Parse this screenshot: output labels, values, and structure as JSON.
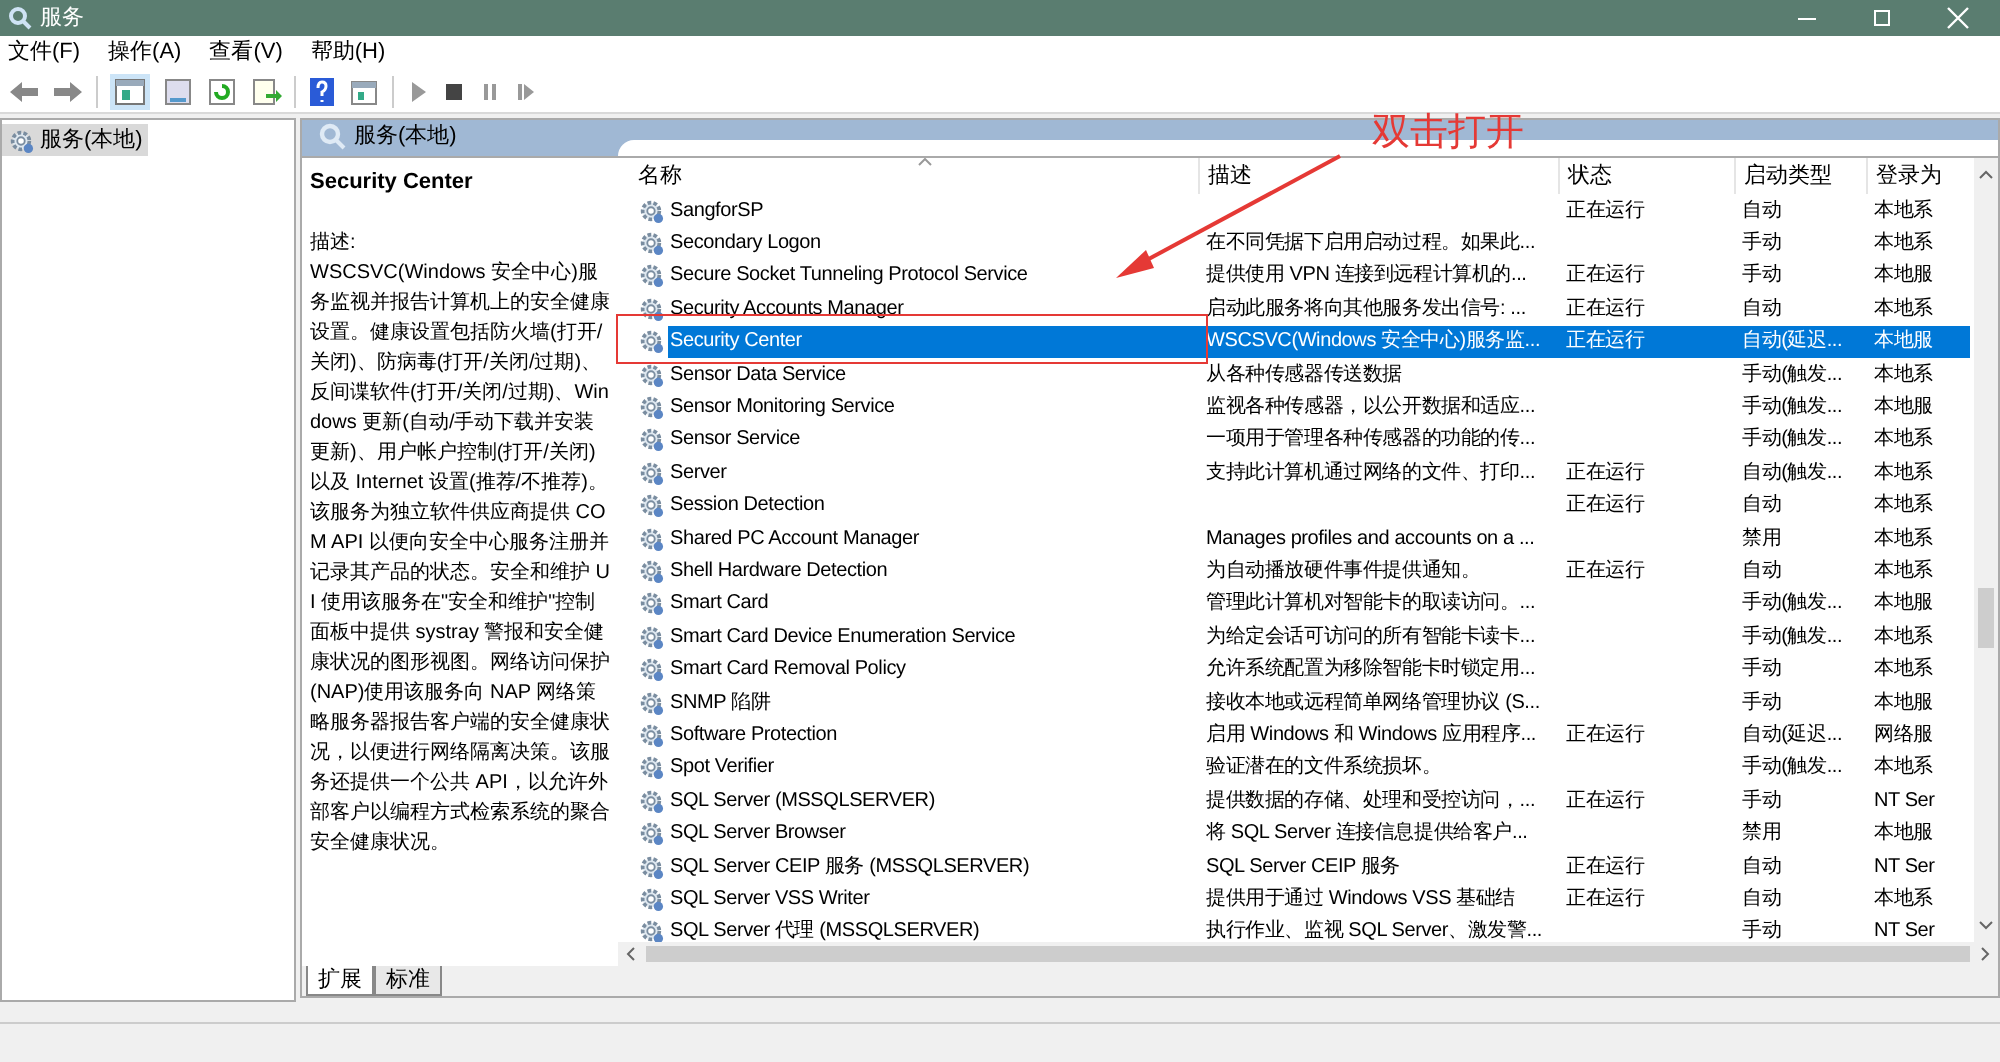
{
  "window": {
    "title": "服务"
  },
  "menu": [
    "文件(F)",
    "操作(A)",
    "查看(V)",
    "帮助(H)"
  ],
  "tree": {
    "items": [
      {
        "label": "服务(本地)",
        "selected": true
      }
    ]
  },
  "panel": {
    "title": "服务(本地)"
  },
  "details": {
    "service_name": "Security Center",
    "description_label": "描述:",
    "description": "WSCSVC(Windows 安全中心)服务监视并报告计算机上的安全健康设置。健康设置包括防火墙(打开/关闭)、防病毒(打开/关闭/过期)、反间谍软件(打开/关闭/过期)、Windows 更新(自动/手动下载并安装更新)、用户帐户控制(打开/关闭)以及 Internet 设置(推荐/不推荐)。该服务为独立软件供应商提供 COM API 以便向安全中心服务注册并记录其产品的状态。安全和维护 UI 使用该服务在\"安全和维护\"控制面板中提供 systray 警报和安全健康状况的图形视图。网络访问保护(NAP)使用该服务向 NAP 网络策略服务器报告客户端的安全健康状况，以便进行网络隔离决策。该服务还提供一个公共 API，以允许外部客户以编程方式检索系统的聚合安全健康状况。"
  },
  "table": {
    "columns": [
      "名称",
      "描述",
      "状态",
      "启动类型",
      "登录为"
    ],
    "rows": [
      {
        "name": "SangforSP",
        "description": "",
        "status": "正在运行",
        "startup_type": "自动",
        "log_on_as": "本地系",
        "selected": false
      },
      {
        "name": "Secondary Logon",
        "description": "在不同凭据下启用启动过程。如果此...",
        "status": "",
        "startup_type": "手动",
        "log_on_as": "本地系",
        "selected": false
      },
      {
        "name": "Secure Socket Tunneling Protocol Service",
        "description": "提供使用 VPN 连接到远程计算机的...",
        "status": "正在运行",
        "startup_type": "手动",
        "log_on_as": "本地服",
        "selected": false
      },
      {
        "name": "Security Accounts Manager",
        "description": "启动此服务将向其他服务发出信号: ...",
        "status": "正在运行",
        "startup_type": "自动",
        "log_on_as": "本地系",
        "selected": false
      },
      {
        "name": "Security Center",
        "description": "WSCSVC(Windows 安全中心)服务监...",
        "status": "正在运行",
        "startup_type": "自动(延迟...",
        "log_on_as": "本地服",
        "selected": true
      },
      {
        "name": "Sensor Data Service",
        "description": "从各种传感器传送数据",
        "status": "",
        "startup_type": "手动(触发...",
        "log_on_as": "本地系",
        "selected": false
      },
      {
        "name": "Sensor Monitoring Service",
        "description": "监视各种传感器，以公开数据和适应...",
        "status": "",
        "startup_type": "手动(触发...",
        "log_on_as": "本地服",
        "selected": false
      },
      {
        "name": "Sensor Service",
        "description": "一项用于管理各种传感器的功能的传...",
        "status": "",
        "startup_type": "手动(触发...",
        "log_on_as": "本地系",
        "selected": false
      },
      {
        "name": "Server",
        "description": "支持此计算机通过网络的文件、打印...",
        "status": "正在运行",
        "startup_type": "自动(触发...",
        "log_on_as": "本地系",
        "selected": false
      },
      {
        "name": "Session Detection",
        "description": "",
        "status": "正在运行",
        "startup_type": "自动",
        "log_on_as": "本地系",
        "selected": false
      },
      {
        "name": "Shared PC Account Manager",
        "description": "Manages profiles and accounts on a ...",
        "status": "",
        "startup_type": "禁用",
        "log_on_as": "本地系",
        "selected": false
      },
      {
        "name": "Shell Hardware Detection",
        "description": "为自动播放硬件事件提供通知。",
        "status": "正在运行",
        "startup_type": "自动",
        "log_on_as": "本地系",
        "selected": false
      },
      {
        "name": "Smart Card",
        "description": "管理此计算机对智能卡的取读访问。...",
        "status": "",
        "startup_type": "手动(触发...",
        "log_on_as": "本地服",
        "selected": false
      },
      {
        "name": "Smart Card Device Enumeration Service",
        "description": "为给定会话可访问的所有智能卡读卡...",
        "status": "",
        "startup_type": "手动(触发...",
        "log_on_as": "本地系",
        "selected": false
      },
      {
        "name": "Smart Card Removal Policy",
        "description": "允许系统配置为移除智能卡时锁定用...",
        "status": "",
        "startup_type": "手动",
        "log_on_as": "本地系",
        "selected": false
      },
      {
        "name": "SNMP 陷阱",
        "description": "接收本地或远程简单网络管理协议 (S...",
        "status": "",
        "startup_type": "手动",
        "log_on_as": "本地服",
        "selected": false
      },
      {
        "name": "Software Protection",
        "description": "启用 Windows 和 Windows 应用程序...",
        "status": "正在运行",
        "startup_type": "自动(延迟...",
        "log_on_as": "网络服",
        "selected": false
      },
      {
        "name": "Spot Verifier",
        "description": "验证潜在的文件系统损坏。",
        "status": "",
        "startup_type": "手动(触发...",
        "log_on_as": "本地系",
        "selected": false
      },
      {
        "name": "SQL Server (MSSQLSERVER)",
        "description": "提供数据的存储、处理和受控访问，...",
        "status": "正在运行",
        "startup_type": "手动",
        "log_on_as": "NT Ser",
        "selected": false
      },
      {
        "name": "SQL Server Browser",
        "description": "将 SQL Server 连接信息提供给客户...",
        "status": "",
        "startup_type": "禁用",
        "log_on_as": "本地服",
        "selected": false
      },
      {
        "name": "SQL Server CEIP 服务 (MSSQLSERVER)",
        "description": "SQL Server CEIP 服务",
        "status": "正在运行",
        "startup_type": "自动",
        "log_on_as": "NT Ser",
        "selected": false
      },
      {
        "name": "SQL Server VSS Writer",
        "description": "提供用于通过 Windows VSS 基础结",
        "status": "正在运行",
        "startup_type": "自动",
        "log_on_as": "本地系",
        "selected": false
      },
      {
        "name": "SQL Server 代理 (MSSQLSERVER)",
        "description": "执行作业、监视 SQL Server、激发警...",
        "status": "",
        "startup_type": "手动",
        "log_on_as": "NT Ser",
        "selected": false
      }
    ]
  },
  "view_tabs": [
    {
      "label": "扩展",
      "selected": true
    },
    {
      "label": "标准",
      "selected": false
    }
  ],
  "annotation": {
    "text": "双击打开"
  }
}
